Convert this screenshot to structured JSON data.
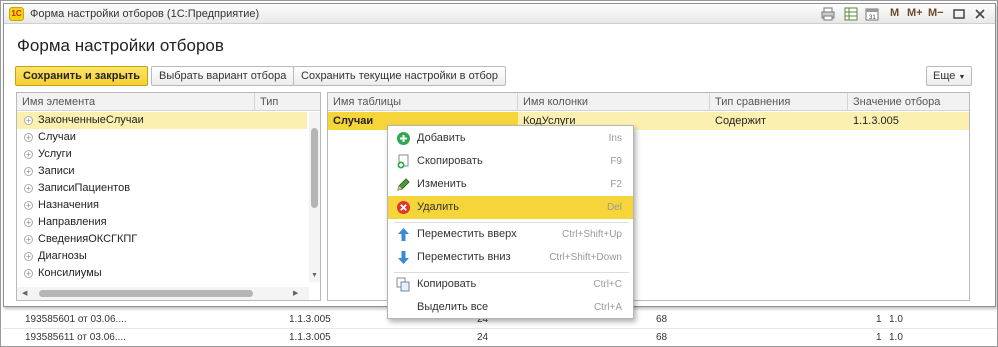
{
  "window": {
    "title": "Форма настройки отборов  (1С:Предприятие)",
    "logo_text": "1С",
    "toolbar_m_buttons": [
      "M",
      "M+",
      "M−"
    ]
  },
  "form": {
    "title": "Форма настройки отборов",
    "buttons": {
      "save_close": "Сохранить и закрыть",
      "choose_variant": "Выбрать вариант отбора",
      "save_current": "Сохранить текущие настройки в отбор",
      "more": "Еще"
    }
  },
  "tree": {
    "columns": [
      "Имя элемента",
      "Тип"
    ],
    "items": [
      {
        "label": "ЗаконченныеСлучаи",
        "selected": true
      },
      {
        "label": "Случаи"
      },
      {
        "label": "Услуги"
      },
      {
        "label": "Записи"
      },
      {
        "label": "ЗаписиПациентов"
      },
      {
        "label": "Назначения"
      },
      {
        "label": "Направления"
      },
      {
        "label": "СведенияОКСГКПГ"
      },
      {
        "label": "Диагнозы"
      },
      {
        "label": "Консилиумы"
      }
    ]
  },
  "filters": {
    "columns": [
      "Имя таблицы",
      "Имя колонки",
      "Тип сравнения",
      "Значение отбора"
    ],
    "rows": [
      {
        "table": "Случаи",
        "column": "КодУслуги",
        "comparison": "Содержит",
        "value": "1.1.3.005"
      }
    ]
  },
  "context_menu": {
    "items": [
      {
        "label": "Добавить",
        "shortcut": "Ins",
        "icon": "add-icon"
      },
      {
        "label": "Скопировать",
        "shortcut": "F9",
        "icon": "copy-row-icon"
      },
      {
        "label": "Изменить",
        "shortcut": "F2",
        "icon": "pencil-icon"
      },
      {
        "label": "Удалить",
        "shortcut": "Del",
        "icon": "delete-icon",
        "highlighted": true
      },
      {
        "label": "Переместить вверх",
        "shortcut": "Ctrl+Shift+Up",
        "icon": "arrow-up-icon"
      },
      {
        "label": "Переместить вниз",
        "shortcut": "Ctrl+Shift+Down",
        "icon": "arrow-down-icon"
      },
      {
        "label": "Копировать",
        "shortcut": "Ctrl+C",
        "icon": "clipboard-copy-icon"
      },
      {
        "label": "Выделить все",
        "shortcut": "Ctrl+A"
      }
    ]
  },
  "background_rows": [
    {
      "name": "193585601 от 03.06....",
      "code": "1.1.3.005",
      "n1": "24",
      "n2": "68",
      "n3": "1",
      "n4": "1.0"
    },
    {
      "name": "193585611 от 03.06....",
      "code": "1.1.3.005",
      "n1": "24",
      "n2": "68",
      "n3": "1",
      "n4": "1.0"
    }
  ],
  "colors": {
    "accent_yellow": "#f6d53a",
    "selection_row": "#fbf0b0",
    "delete_red": "#e0362b",
    "add_green": "#2fa84f",
    "move_blue": "#3a8ad6"
  }
}
